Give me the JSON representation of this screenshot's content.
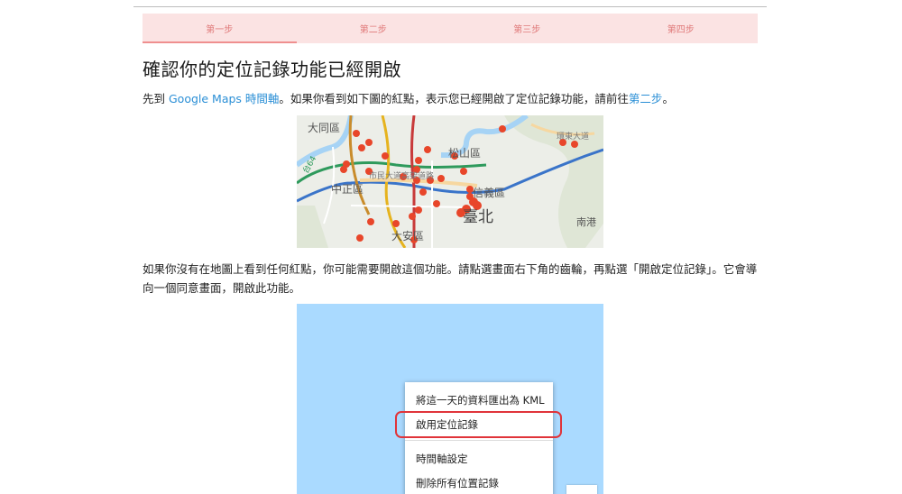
{
  "steps": [
    {
      "label": "第一步"
    },
    {
      "label": "第二步"
    },
    {
      "label": "第三步"
    },
    {
      "label": "第四步"
    }
  ],
  "page_title": "確認你的定位記錄功能已經開啟",
  "intro": {
    "prefix": "先到 ",
    "link_timeline": "Google Maps 時間軸",
    "middle": "。如果你看到如下圖的紅點，表示您已經開啟了定位記錄功能，請前往",
    "link_step2": "第二步",
    "suffix": "。"
  },
  "map_labels": {
    "datong": "大同區",
    "songshan": "松山區",
    "zhongzheng": "中正區",
    "xinyi": "信義區",
    "taipei": "臺北",
    "daan": "大安區",
    "nangang": "南港",
    "civic_blvd": "市民大道高架道路",
    "huandong": "環東大道",
    "expressway": "台64"
  },
  "instruction": "如果你沒有在地圖上看到任何紅點，你可能需要開啟這個功能。請點選畫面右下角的齒輪，再點選「開啟定位記錄」。它會導向一個同意畫面，開啟此功能。",
  "menu": {
    "export_kml": "將這一天的資料匯出為 KML",
    "enable_history": "啟用定位記錄",
    "timeline_settings": "時間軸設定",
    "delete_all": "刪除所有位置記錄"
  },
  "colors": {
    "step_bar": "#fbe3e3",
    "step_text": "#e07a7a",
    "link": "#2b8fd6",
    "highlight": "#e0343a",
    "water": "#aadaff",
    "dot": "#e8462a"
  }
}
